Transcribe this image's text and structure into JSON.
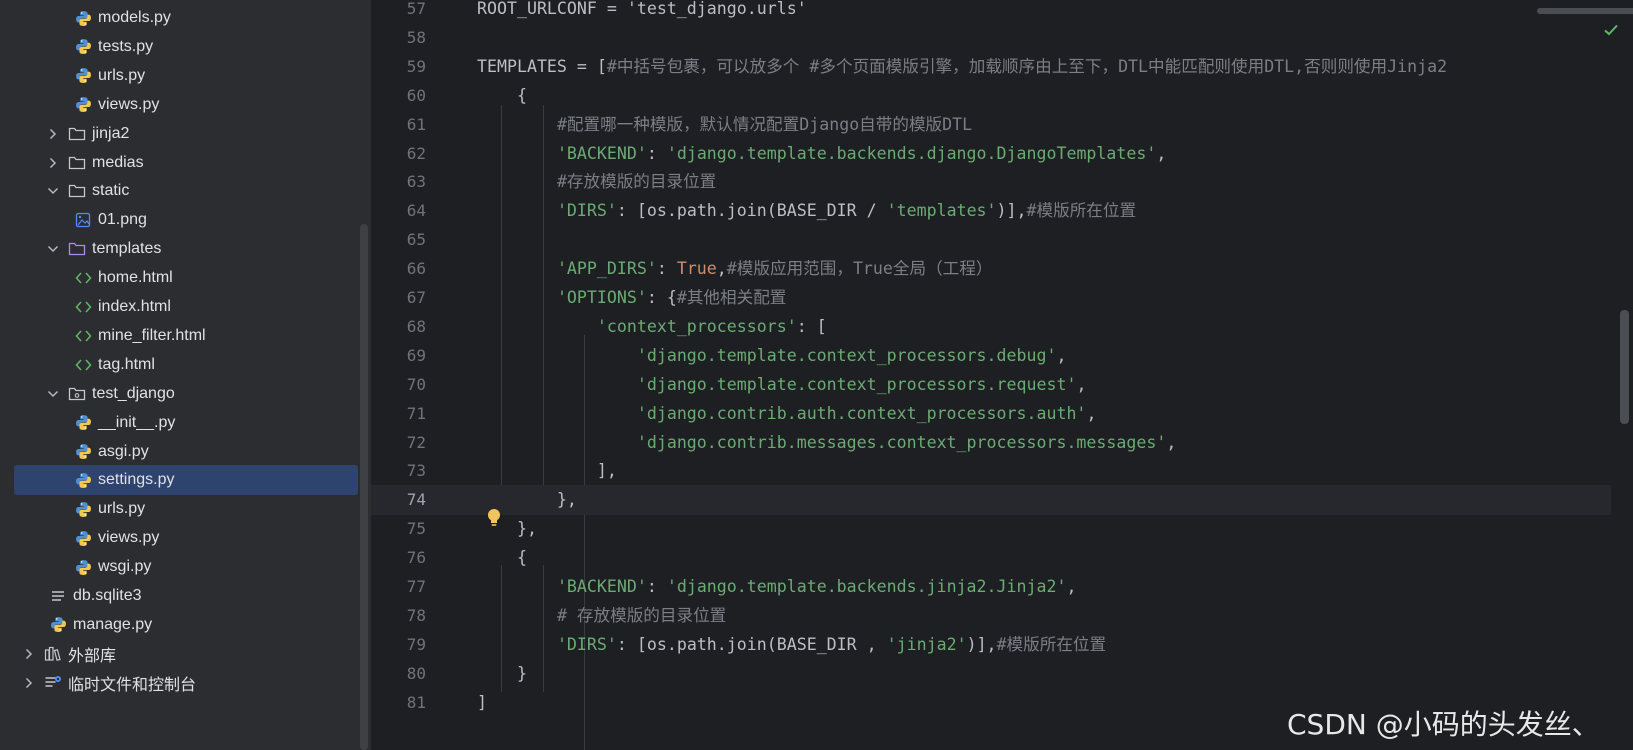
{
  "tree": [
    {
      "label": "models.py",
      "kind": "py"
    },
    {
      "label": "tests.py",
      "kind": "py"
    },
    {
      "label": "urls.py",
      "kind": "py"
    },
    {
      "label": "views.py",
      "kind": "py"
    },
    {
      "label": "jinja2",
      "kind": "folder",
      "state": "collapsed"
    },
    {
      "label": "medias",
      "kind": "folder",
      "state": "collapsed"
    },
    {
      "label": "static",
      "kind": "folder",
      "state": "expanded"
    },
    {
      "label": "01.png",
      "kind": "image"
    },
    {
      "label": "templates",
      "kind": "template-folder",
      "state": "expanded"
    },
    {
      "label": "home.html",
      "kind": "html"
    },
    {
      "label": "index.html",
      "kind": "html"
    },
    {
      "label": "mine_filter.html",
      "kind": "html"
    },
    {
      "label": "tag.html",
      "kind": "html"
    },
    {
      "label": "test_django",
      "kind": "package",
      "state": "expanded"
    },
    {
      "label": "__init__.py",
      "kind": "py"
    },
    {
      "label": "asgi.py",
      "kind": "py"
    },
    {
      "label": "settings.py",
      "kind": "py",
      "selected": true
    },
    {
      "label": "urls.py",
      "kind": "py"
    },
    {
      "label": "views.py",
      "kind": "py"
    },
    {
      "label": "wsgi.py",
      "kind": "py"
    },
    {
      "label": "db.sqlite3",
      "kind": "db"
    },
    {
      "label": "manage.py",
      "kind": "py"
    },
    {
      "label": "外部库",
      "kind": "library",
      "state": "collapsed"
    },
    {
      "label": "临时文件和控制台",
      "kind": "scratch",
      "state": "collapsed"
    }
  ],
  "editor": {
    "current_line": "74",
    "lines": [
      {
        "n": "57",
        "parts": [
          [
            "t",
            "ROOT_URLCONF = 'test_django.urls'"
          ]
        ]
      },
      {
        "n": "58",
        "parts": []
      },
      {
        "n": "59",
        "parts": [
          [
            "t",
            "TEMPLATES = ["
          ],
          [
            "c",
            "#中括号包裹，可以放多个 #多个页面模版引擎，加载顺序由上至下，DTL中能匹配则使用DTL,否则则使用Jinja2"
          ]
        ]
      },
      {
        "n": "60",
        "parts": [
          [
            "t",
            "    {"
          ]
        ]
      },
      {
        "n": "61",
        "parts": [
          [
            "t",
            "        "
          ],
          [
            "c",
            "#配置哪一种模版，默认情况配置Django自带的模版DTL"
          ]
        ]
      },
      {
        "n": "62",
        "parts": [
          [
            "t",
            "        "
          ],
          [
            "s",
            "'BACKEND'"
          ],
          [
            "t",
            ": "
          ],
          [
            "s",
            "'django.template.backends.django.DjangoTemplates'"
          ],
          [
            "t",
            ","
          ]
        ]
      },
      {
        "n": "63",
        "parts": [
          [
            "t",
            "        "
          ],
          [
            "c",
            "#存放模版的目录位置"
          ]
        ]
      },
      {
        "n": "64",
        "parts": [
          [
            "t",
            "        "
          ],
          [
            "s",
            "'DIRS'"
          ],
          [
            "t",
            ": [os.path.join(BASE_DIR / "
          ],
          [
            "s",
            "'templates'"
          ],
          [
            "t",
            ")],"
          ],
          [
            "c",
            "#模版所在位置"
          ]
        ]
      },
      {
        "n": "65",
        "parts": []
      },
      {
        "n": "66",
        "parts": [
          [
            "t",
            "        "
          ],
          [
            "s",
            "'APP_DIRS'"
          ],
          [
            "t",
            ": "
          ],
          [
            "k",
            "True"
          ],
          [
            "t",
            ","
          ],
          [
            "c",
            "#模版应用范围，True全局（工程）"
          ]
        ]
      },
      {
        "n": "67",
        "parts": [
          [
            "t",
            "        "
          ],
          [
            "s",
            "'OPTIONS'"
          ],
          [
            "t",
            ": {"
          ],
          [
            "c",
            "#其他相关配置"
          ]
        ]
      },
      {
        "n": "68",
        "parts": [
          [
            "t",
            "            "
          ],
          [
            "s",
            "'context_processors'"
          ],
          [
            "t",
            ": ["
          ]
        ]
      },
      {
        "n": "69",
        "parts": [
          [
            "t",
            "                "
          ],
          [
            "s",
            "'django.template.context_processors.debug'"
          ],
          [
            "t",
            ","
          ]
        ]
      },
      {
        "n": "70",
        "parts": [
          [
            "t",
            "                "
          ],
          [
            "s",
            "'django.template.context_processors.request'"
          ],
          [
            "t",
            ","
          ]
        ]
      },
      {
        "n": "71",
        "parts": [
          [
            "t",
            "                "
          ],
          [
            "s",
            "'django.contrib.auth.context_processors.auth'"
          ],
          [
            "t",
            ","
          ]
        ]
      },
      {
        "n": "72",
        "parts": [
          [
            "t",
            "                "
          ],
          [
            "s",
            "'django.contrib.messages.context_processors.messages'"
          ],
          [
            "t",
            ","
          ]
        ]
      },
      {
        "n": "73",
        "parts": [
          [
            "t",
            "            ],"
          ]
        ]
      },
      {
        "n": "74",
        "parts": [
          [
            "t",
            "        },"
          ]
        ]
      },
      {
        "n": "75",
        "parts": [
          [
            "t",
            "    },"
          ]
        ]
      },
      {
        "n": "76",
        "parts": [
          [
            "t",
            "    {"
          ]
        ]
      },
      {
        "n": "77",
        "parts": [
          [
            "t",
            "        "
          ],
          [
            "s",
            "'BACKEND'"
          ],
          [
            "t",
            ": "
          ],
          [
            "s",
            "'django.template.backends.jinja2.Jinja2'"
          ],
          [
            "t",
            ","
          ]
        ]
      },
      {
        "n": "78",
        "parts": [
          [
            "t",
            "        "
          ],
          [
            "c",
            "# 存放模版的目录位置"
          ]
        ]
      },
      {
        "n": "79",
        "parts": [
          [
            "t",
            "        "
          ],
          [
            "s",
            "'DIRS'"
          ],
          [
            "t",
            ": [os.path.join(BASE_DIR , "
          ],
          [
            "s",
            "'jinja2'"
          ],
          [
            "t",
            ")],"
          ],
          [
            "c",
            "#模版所在位置"
          ]
        ]
      },
      {
        "n": "80",
        "parts": [
          [
            "t",
            "    }"
          ]
        ]
      },
      {
        "n": "81",
        "parts": [
          [
            "t",
            "]"
          ]
        ]
      }
    ]
  },
  "watermark": "CSDN @小码的头发丝、",
  "colors": {
    "sidebar_bg": "#2b2d30",
    "editor_bg": "#1e1f22",
    "selection": "#2e436e",
    "string": "#6aab73",
    "comment": "#7a7e85",
    "keyword": "#cf8e6d",
    "text": "#bcbec4",
    "line_number": "#6f737a"
  }
}
